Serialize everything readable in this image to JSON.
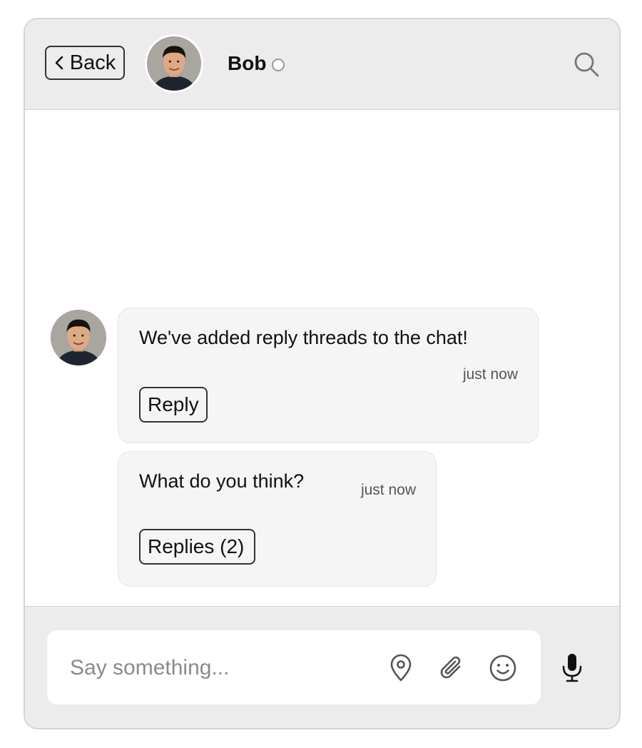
{
  "header": {
    "back_label": "Back",
    "user_name": "Bob"
  },
  "messages": [
    {
      "text": "We've added reply threads to the chat!",
      "time": "just now",
      "action_label": "Reply"
    },
    {
      "text": "What do you think?",
      "time": "just now",
      "action_label": "Replies (2)"
    }
  ],
  "composer": {
    "placeholder": "Say something..."
  },
  "icons": {
    "back": "chevron-left-icon",
    "search": "search-icon",
    "location": "location-pin-icon",
    "attach": "paperclip-icon",
    "emoji": "smiley-icon",
    "mic": "microphone-icon"
  }
}
